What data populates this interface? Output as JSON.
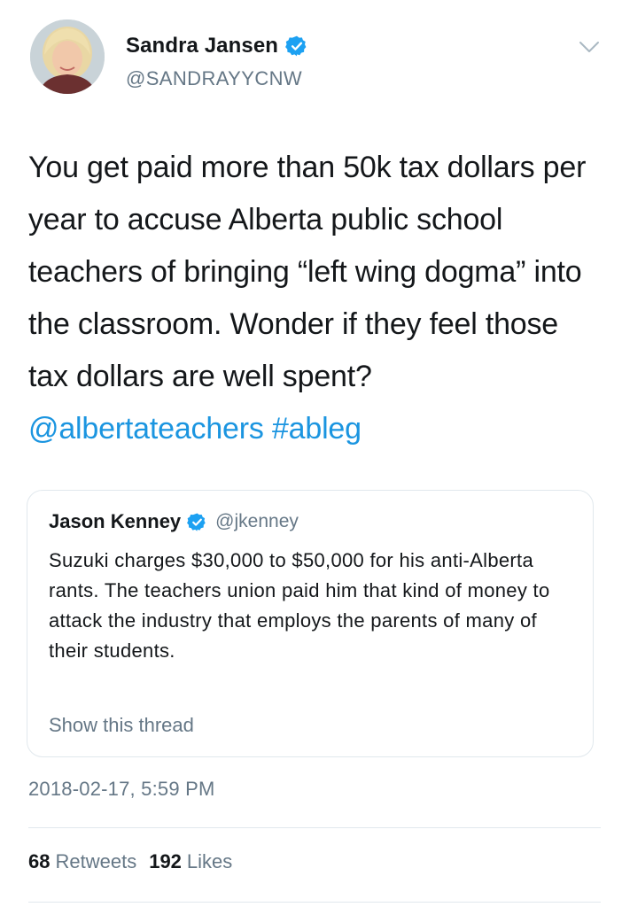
{
  "author": {
    "display_name": "Sandra Jansen",
    "handle": "@SANDRAYYCNW",
    "verified": true,
    "avatar_icon": "profile-photo"
  },
  "tweet": {
    "text_plain": "You get paid more than 50k tax dollars per year to accuse Alberta public school teachers of bringing “left wing dogma” into the classroom. Wonder if they feel those tax dollars are well spent? ",
    "mention": "@albertateachers",
    "hashtag": "#ableg",
    "timestamp": "2018-02-17, 5:59 PM"
  },
  "quoted_tweet": {
    "display_name": "Jason Kenney",
    "handle": "@jkenney",
    "verified": true,
    "text": "Suzuki charges $30,000 to $50,000 for his anti-Alberta rants. The teachers union paid him that kind of money to attack the industry that employs the parents of many of their students.",
    "show_thread_label": "Show this thread"
  },
  "stats": {
    "retweets_count": "68",
    "retweets_label": "Retweets",
    "likes_count": "192",
    "likes_label": "Likes"
  },
  "colors": {
    "link": "#1b95e0",
    "verified_badge": "#1da1f2",
    "secondary_text": "#657786",
    "border": "#e1e8ed"
  }
}
